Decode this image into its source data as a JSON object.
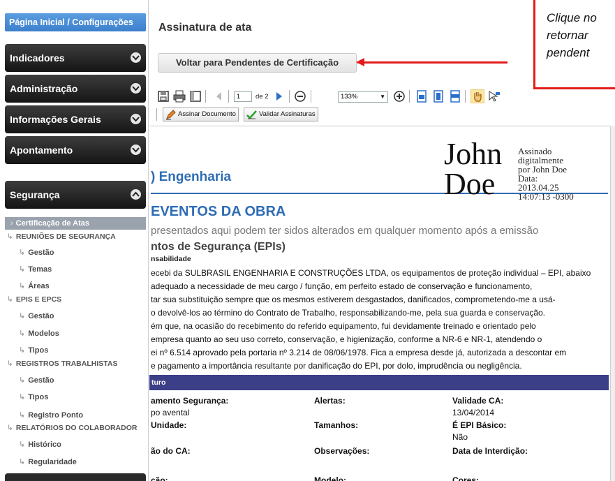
{
  "sidebar": {
    "home": "Página Inicial / Configurações",
    "menus": [
      "Indicadores",
      "Administração",
      "Informações Gerais",
      "Apontamento",
      "Segurança"
    ],
    "submenu": {
      "active": "Certificação de Atas",
      "reunioes": "REUNIÕES DE SEGURANÇA",
      "reunioes_items": [
        "Gestão",
        "Temas",
        "Áreas"
      ],
      "epis": "EPIS E EPCS",
      "epis_items": [
        "Gestão",
        "Modelos",
        "Tipos"
      ],
      "registros": "REGISTROS TRABALHISTAS",
      "registros_items": [
        "Gestão",
        "Tipos",
        "Registro Ponto"
      ],
      "relatorios": "RELATÓRIOS DO COLABORADOR",
      "relatorios_items": [
        "Histórico",
        "Regularidade"
      ]
    }
  },
  "main": {
    "title": "Assinatura de ata",
    "back_button": "Voltar para Pendentes de Certificação",
    "callout_lines": [
      "Clique no",
      "retornar",
      "pendent"
    ]
  },
  "viewer": {
    "page_current": "1",
    "page_of": "de 2",
    "zoom": "133%",
    "sign_button": "Assinar Documento",
    "validate_button": "Validar Assinaturas"
  },
  "document": {
    "logo": ") Engenharia",
    "title": "EVENTOS DA OBRA",
    "subtitle": "presentados aqui podem ter sidos alterados em qualquer momento após a emissão",
    "signature": {
      "name_line1": "John",
      "name_line2": "Doe",
      "meta": [
        "Assinado",
        "digitalmente",
        "por John Doe",
        "Data:",
        "2013.04.25",
        "14:07:13 -0300"
      ]
    },
    "section_heading": "ntos de Segurança (EPIs)",
    "section_sub": "nsabilidade",
    "paragraph": [
      "ecebi da SULBRASIL ENGENHARIA E CONSTRUÇÕES LTDA, os equipamentos de proteção individual – EPI, abaixo",
      "adequado a necessidade de meu cargo / função, em perfeito estado de conservação e funcionamento,",
      "tar sua substituição sempre que os mesmos estiverem desgastados, danificados, comprometendo-me a usá-",
      "o devolvê-los ao término do Contrato de Trabalho, responsabilizando-me, pela sua guarda e conservação.",
      "ém que, na ocasião do recebimento do referido equipamento, fui devidamente treinado e orientado pelo",
      "empresa quanto ao seu uso correto, conservação, e higienização, conforme a NR-6 e NR-1, atendendo o",
      "ei nº 6.514 aprovado pela portaria nº 3.214 de 08/06/1978. Fica a empresa desde já, autorizada a descontar em",
      "e pagamento a importância resultante por danificação do EPI, por dolo, imprudência ou negligência."
    ],
    "band": "turo",
    "fields": {
      "equip_label": "amento Segurança:",
      "equip_value": "po avental",
      "alertas_label": "Alertas:",
      "validade_label": "Validade CA:",
      "validade_value": "13/04/2014",
      "unidade_label": "Unidade:",
      "tamanhos_label": "Tamanhos:",
      "epi_basico_label": "É EPI Básico:",
      "epi_basico_value": "Não",
      "ca_label": "ão do CA:",
      "obs_label": "Observações:",
      "interdicao_label": "Data de Interdição:",
      "r6_label": "ção:",
      "modelo_label": "Modelo:",
      "cores_label": "Cores:"
    }
  },
  "colors": {
    "accent_red": "#e31b1b",
    "brand_blue": "#2e6db5",
    "band_navy": "#3b3f87"
  }
}
